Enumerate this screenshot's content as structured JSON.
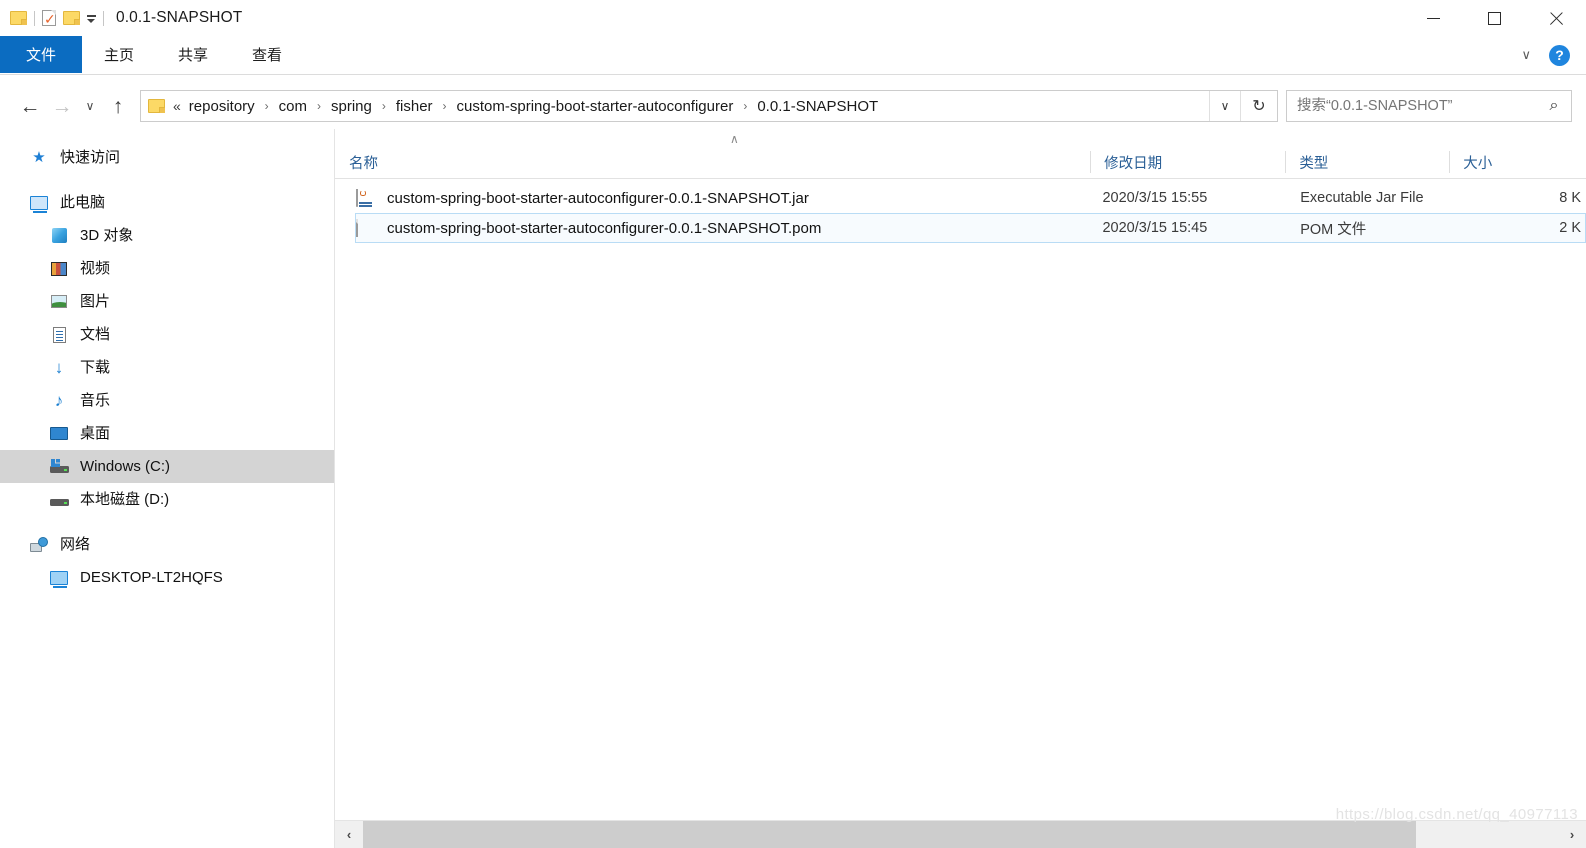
{
  "window": {
    "title": "0.0.1-SNAPSHOT",
    "quick_access": [
      {
        "name": "folder-icon",
        "label": ""
      },
      {
        "name": "properties-icon",
        "label": ""
      },
      {
        "name": "new-folder-icon",
        "label": ""
      },
      {
        "name": "customize-qat-icon",
        "label": ""
      }
    ],
    "controls": {
      "minimize": "—",
      "maximize": "□",
      "close": "✕"
    }
  },
  "ribbon": {
    "tabs": [
      {
        "label": "文件",
        "active": true
      },
      {
        "label": "主页",
        "active": false
      },
      {
        "label": "共享",
        "active": false
      },
      {
        "label": "查看",
        "active": false
      }
    ],
    "collapse_chevron": "∨",
    "help_label": "?"
  },
  "address": {
    "back": "←",
    "forward": "→",
    "recent": "∨",
    "up": "↑",
    "ellipsis": "«",
    "separator": "›",
    "crumbs": [
      "repository",
      "com",
      "spring",
      "fisher",
      "custom-spring-boot-starter-autoconfigurer",
      "0.0.1-SNAPSHOT"
    ],
    "dropdown": "∨",
    "refresh": "↻"
  },
  "search": {
    "placeholder": "搜索“0.0.1-SNAPSHOT”",
    "value": "",
    "icon": "⌕"
  },
  "sidebar": {
    "items": [
      {
        "label": "快速访问",
        "icon": "star-icon",
        "level": 0,
        "selected": false,
        "gap": false
      },
      {
        "label": "此电脑",
        "icon": "this-pc-icon",
        "level": 0,
        "selected": false,
        "gap": true
      },
      {
        "label": "3D 对象",
        "icon": "3d-objects-icon",
        "level": 1,
        "selected": false,
        "gap": false
      },
      {
        "label": "视频",
        "icon": "videos-icon",
        "level": 1,
        "selected": false,
        "gap": false
      },
      {
        "label": "图片",
        "icon": "pictures-icon",
        "level": 1,
        "selected": false,
        "gap": false
      },
      {
        "label": "文档",
        "icon": "documents-icon",
        "level": 1,
        "selected": false,
        "gap": false
      },
      {
        "label": "下载",
        "icon": "downloads-icon",
        "level": 1,
        "selected": false,
        "gap": false
      },
      {
        "label": "音乐",
        "icon": "music-icon",
        "level": 1,
        "selected": false,
        "gap": false
      },
      {
        "label": "桌面",
        "icon": "desktop-icon",
        "level": 1,
        "selected": false,
        "gap": false
      },
      {
        "label": "Windows (C:)",
        "icon": "windows-drive-icon",
        "level": 1,
        "selected": true,
        "gap": false
      },
      {
        "label": "本地磁盘 (D:)",
        "icon": "drive-icon",
        "level": 1,
        "selected": false,
        "gap": false
      },
      {
        "label": "网络",
        "icon": "network-icon",
        "level": 0,
        "selected": false,
        "gap": true
      },
      {
        "label": "DESKTOP-LT2HQFS",
        "icon": "computer-icon",
        "level": 1,
        "selected": false,
        "gap": false
      }
    ]
  },
  "filelist": {
    "sort_caret": "∧",
    "columns": [
      {
        "key": "name",
        "label": "名称"
      },
      {
        "key": "date",
        "label": "修改日期"
      },
      {
        "key": "type",
        "label": "类型"
      },
      {
        "key": "size",
        "label": "大小"
      }
    ],
    "rows": [
      {
        "icon": "jar-file-icon",
        "name": "custom-spring-boot-starter-autoconfigurer-0.0.1-SNAPSHOT.jar",
        "date": "2020/3/15 15:55",
        "type": "Executable Jar File",
        "size": "8 K",
        "hovered": false
      },
      {
        "icon": "pom-file-icon",
        "name": "custom-spring-boot-starter-autoconfigurer-0.0.1-SNAPSHOT.pom",
        "date": "2020/3/15 15:45",
        "type": "POM 文件",
        "size": "2 K",
        "hovered": true
      }
    ]
  },
  "scrollbar": {
    "left_arrow": "‹",
    "right_arrow": "›"
  },
  "watermark": {
    "text": "https://blog.csdn.net/qq_40977113"
  },
  "colors": {
    "accent": "#0b6cc1",
    "header_text": "#2a5f96",
    "selection": "#d4d4d4",
    "hover_border": "#b9dcf5"
  }
}
